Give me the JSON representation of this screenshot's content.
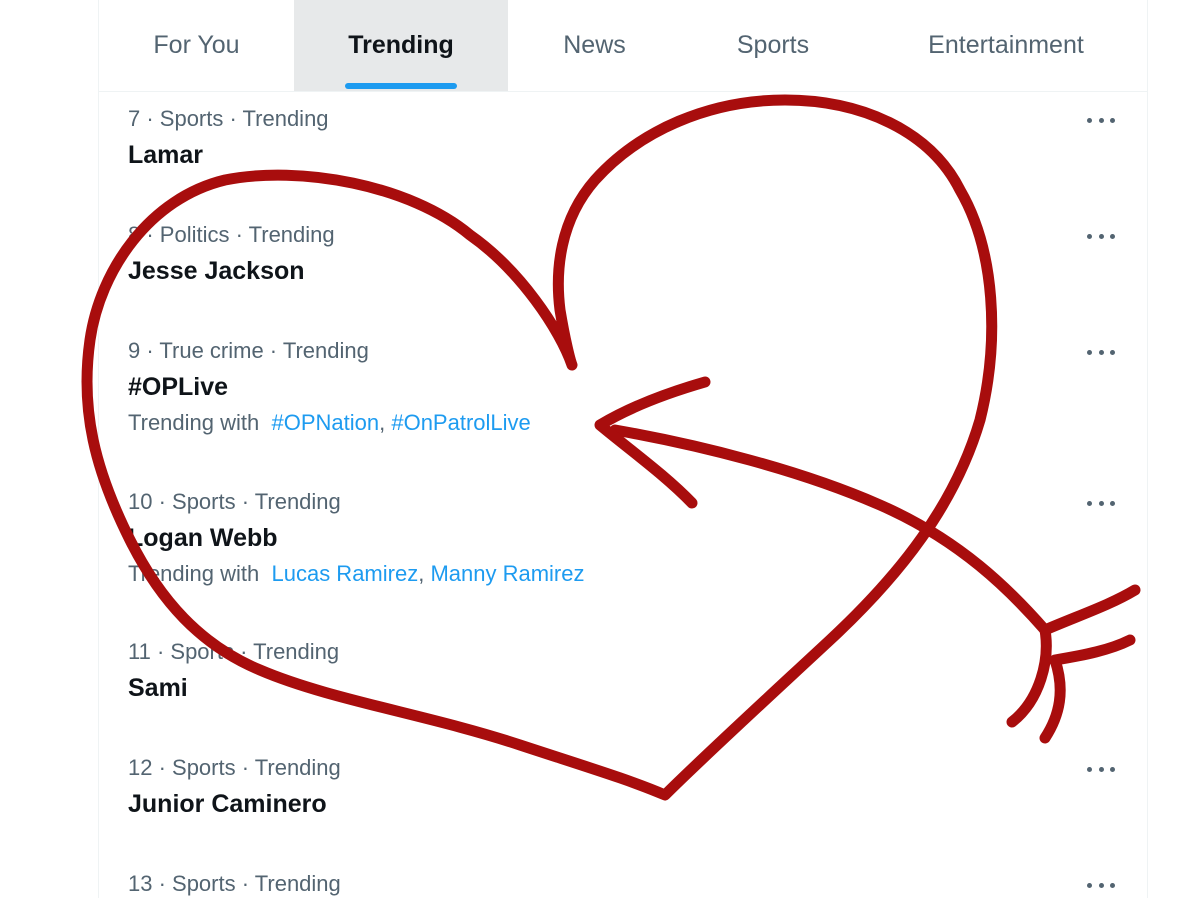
{
  "tabs": [
    {
      "label": "For You",
      "active": false
    },
    {
      "label": "Trending",
      "active": true
    },
    {
      "label": "News",
      "active": false
    },
    {
      "label": "Sports",
      "active": false
    },
    {
      "label": "Entertainment",
      "active": false
    }
  ],
  "trends": [
    {
      "meta": "7 · Sports · Trending",
      "topic": "Lamar"
    },
    {
      "meta": "8 · Politics · Trending",
      "topic": "Jesse Jackson"
    },
    {
      "meta": "9 · True crime · Trending",
      "topic": "#OPLive",
      "with_label": "Trending with",
      "links": [
        "#OPNation",
        "#OnPatrolLive"
      ]
    },
    {
      "meta": "10 · Sports · Trending",
      "topic": "Logan Webb",
      "with_label": "Trending with",
      "links": [
        "Lucas Ramirez",
        "Manny Ramirez"
      ]
    },
    {
      "meta": "11 · Sports · Trending",
      "topic": "Sami"
    },
    {
      "meta": "12 · Sports · Trending",
      "topic": "Junior Caminero"
    },
    {
      "meta": "13 · Sports · Trending",
      "topic": ""
    }
  ],
  "colors": {
    "accent": "#1d9bf0",
    "drawing": "#a80d0d"
  },
  "icons": {
    "more": "more-options-icon",
    "overlay": "hand-drawn-heart-with-arrow"
  }
}
